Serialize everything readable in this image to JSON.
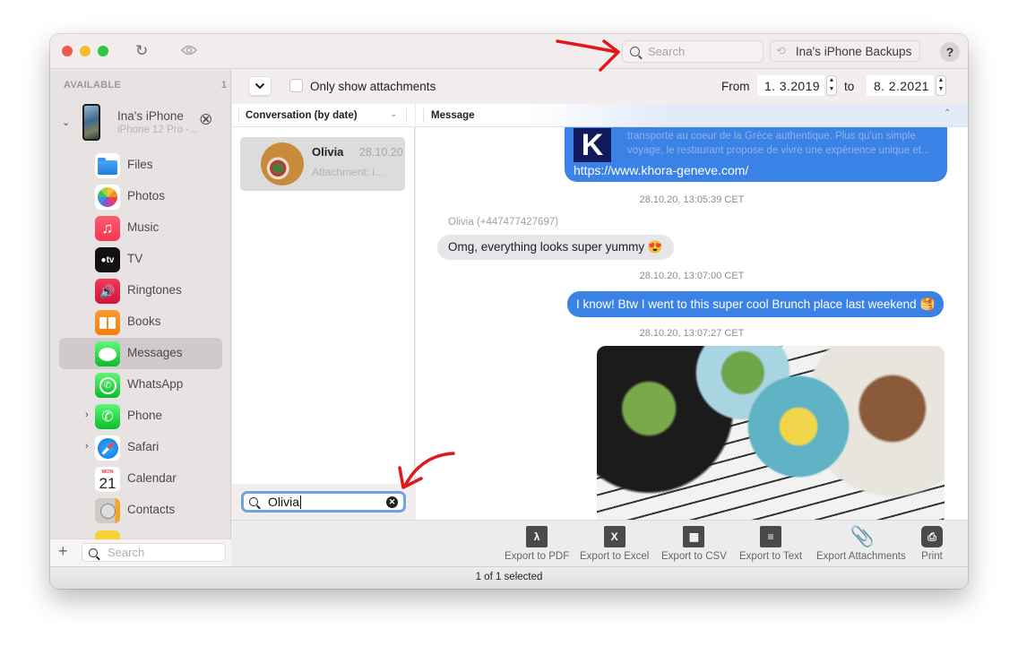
{
  "window": {
    "toolbar": {
      "search_placeholder": "Search",
      "backups_label": "Ina's iPhone Backups",
      "help_label": "?"
    }
  },
  "sidebar": {
    "header": "AVAILABLE",
    "count": "1",
    "device": {
      "name": "Ina's iPhone",
      "model": "iPhone 12 Pro -..."
    },
    "items": [
      {
        "label": "Files",
        "icon": "files-icon"
      },
      {
        "label": "Photos",
        "icon": "photos-icon"
      },
      {
        "label": "Music",
        "icon": "music-icon"
      },
      {
        "label": "TV",
        "icon": "tv-icon"
      },
      {
        "label": "Ringtones",
        "icon": "ringtones-icon"
      },
      {
        "label": "Books",
        "icon": "books-icon"
      },
      {
        "label": "Messages",
        "icon": "messages-icon",
        "selected": true
      },
      {
        "label": "WhatsApp",
        "icon": "whatsapp-icon"
      },
      {
        "label": "Phone",
        "icon": "phone-icon",
        "expandable": true
      },
      {
        "label": "Safari",
        "icon": "safari-icon",
        "expandable": true
      },
      {
        "label": "Calendar",
        "icon": "calendar-icon",
        "calendar_month": "MON",
        "calendar_day": "21"
      },
      {
        "label": "Contacts",
        "icon": "contacts-icon"
      }
    ],
    "search_placeholder": "Search",
    "add_label": "+"
  },
  "filters": {
    "only_attachments_label": "Only show attachments",
    "only_attachments_checked": false,
    "from_label": "From",
    "from_date": "1.  3.2019",
    "to_label": "to",
    "to_date": "8.  2.2021"
  },
  "conversations": {
    "header": "Conversation (by date)",
    "items": [
      {
        "name": "Olivia",
        "date": "28.10.20",
        "preview": "Attachment: i..."
      }
    ],
    "search_value": "Olivia"
  },
  "messages": {
    "header": "Message",
    "link_preview": {
      "description": "transporte au coeur de la Grèce authentique. Plus qu'un simple voyage, le restaurant propose de vivre une expérience unique et...",
      "url": "https://www.khora-geneve.com/"
    },
    "items": [
      {
        "timestamp": "28.10.20, 13:05:39 CET",
        "sender": "Olivia (+447477427697)",
        "text": "Omg, everything looks super yummy 😍",
        "direction": "incoming"
      },
      {
        "timestamp": "28.10.20, 13:07:00 CET",
        "text": "I know! Btw I went to this super cool Brunch place last weekend 🥞",
        "direction": "outgoing"
      },
      {
        "timestamp": "28.10.20, 13:07:27 CET",
        "attachment": "photo",
        "direction": "outgoing"
      }
    ]
  },
  "export": {
    "buttons": [
      {
        "label": "Export to PDF",
        "icon": "pdf-icon"
      },
      {
        "label": "Export to Excel",
        "icon": "excel-icon"
      },
      {
        "label": "Export to CSV",
        "icon": "csv-icon"
      },
      {
        "label": "Export to Text",
        "icon": "text-icon"
      },
      {
        "label": "Export Attachments",
        "icon": "paperclip-icon"
      },
      {
        "label": "Print",
        "icon": "printer-icon"
      }
    ]
  },
  "status": {
    "text": "1 of 1 selected"
  },
  "colors": {
    "accent_blue": "#3b82e6",
    "incoming_bubble": "#e5e5ea",
    "annotation_red": "#e0181b"
  }
}
